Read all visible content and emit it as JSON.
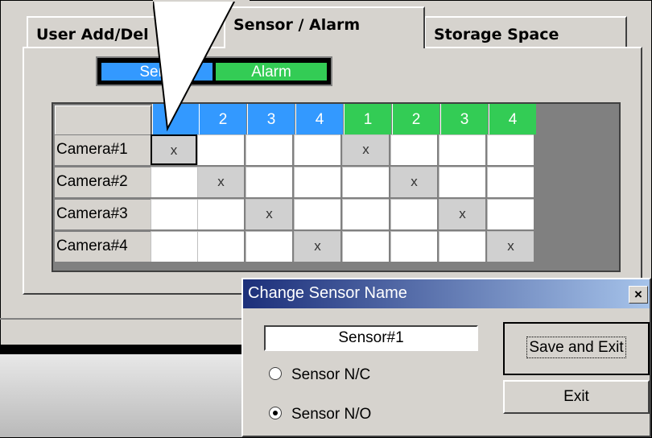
{
  "tabs": [
    {
      "label": "User Add/Del"
    },
    {
      "label": "Sensor / Alarm"
    },
    {
      "label": "Storage Space"
    }
  ],
  "legend": {
    "sensor": "Sens",
    "alarm": "Alarm"
  },
  "grid": {
    "sensor_headers": [
      "",
      "2",
      "3",
      "4"
    ],
    "alarm_headers": [
      "1",
      "2",
      "3",
      "4"
    ],
    "rows": [
      "Camera#1",
      "Camera#2",
      "Camera#3",
      "Camera#4"
    ],
    "mark": "x",
    "selected_cells": [
      [
        0,
        0
      ],
      [
        0,
        4
      ],
      [
        1,
        1
      ],
      [
        1,
        5
      ],
      [
        2,
        2
      ],
      [
        2,
        6
      ],
      [
        3,
        3
      ],
      [
        3,
        7
      ]
    ]
  },
  "colors": {
    "sensor": "#3399ff",
    "alarm": "#33cc55",
    "title_start": "#1c2f7a",
    "title_end": "#a6c3ea"
  },
  "dialog": {
    "title": "Change Sensor Name",
    "close": "×",
    "name_value": "Sensor#1",
    "option_nc": "Sensor N/C",
    "option_no": "Sensor N/O",
    "selected_option": "Sensor N/O",
    "save_exit": "Save and Exit",
    "exit": "Exit"
  }
}
